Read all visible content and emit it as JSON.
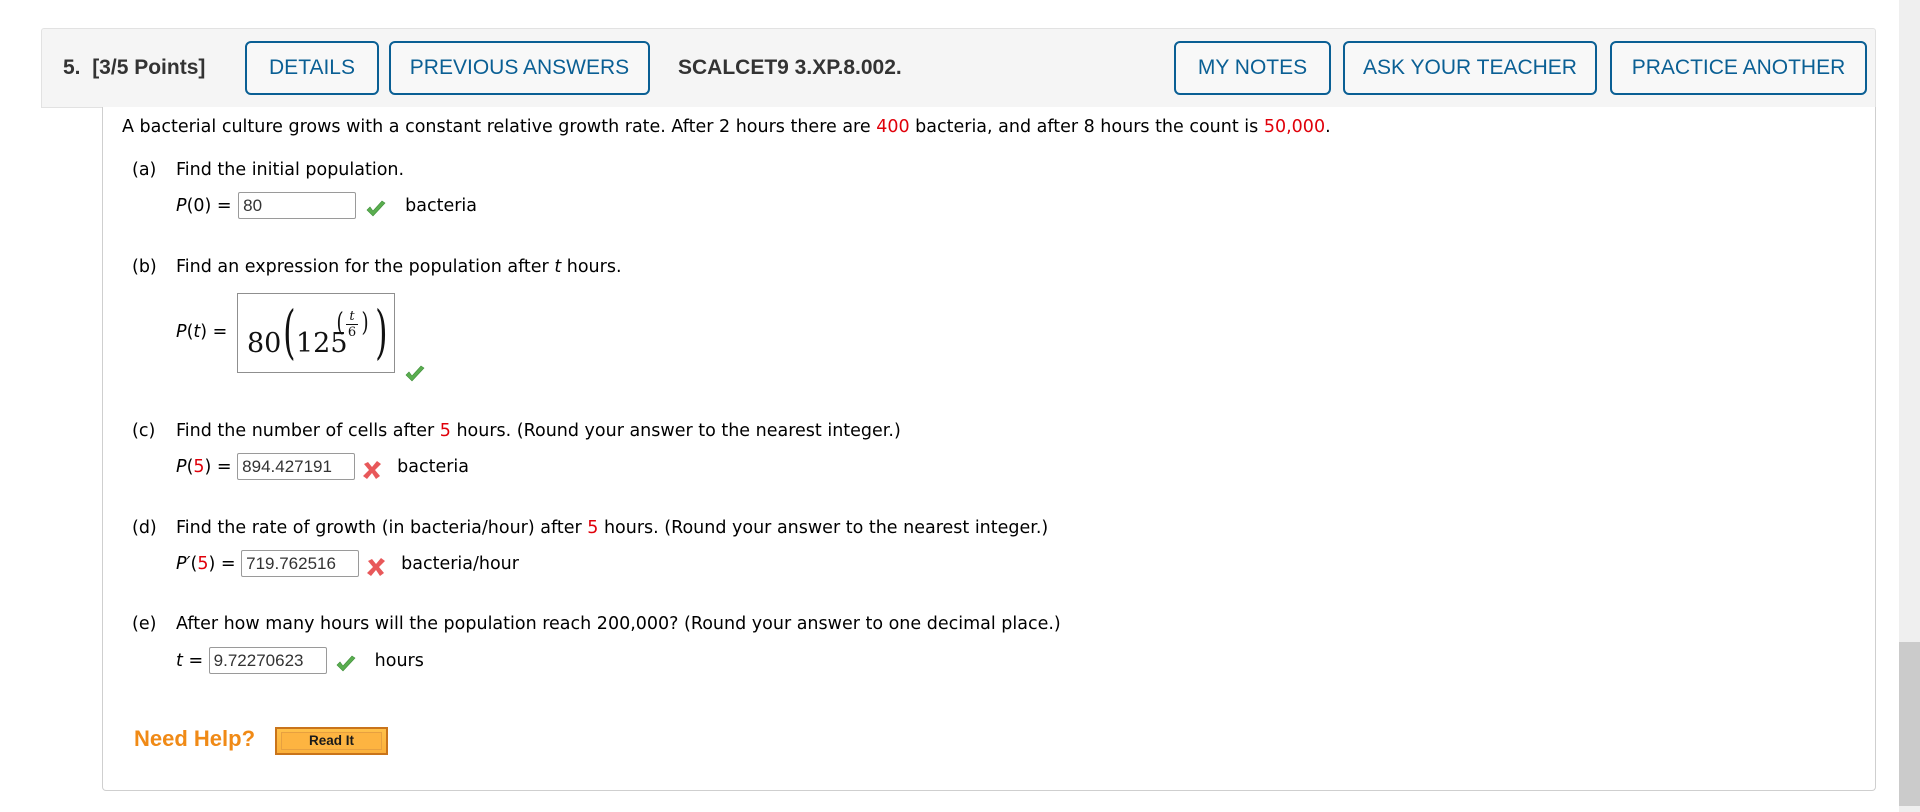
{
  "header": {
    "question_number": "5.",
    "points": "[3/5 Points]",
    "buttons": {
      "details": "DETAILS",
      "previous_answers": "PREVIOUS ANSWERS",
      "my_notes": "MY NOTES",
      "ask_teacher": "ASK YOUR TEACHER",
      "practice_another": "PRACTICE ANOTHER"
    },
    "question_id": "SCALCET9 3.XP.8.002."
  },
  "intro": {
    "part1": "A bacterial culture grows with a constant relative growth rate. After 2 hours there are ",
    "value1": "400",
    "part2": " bacteria, and after 8 hours the count is ",
    "value2": "50,000",
    "part3": "."
  },
  "parts": [
    {
      "label": "(a)",
      "question": "Find the initial population.",
      "lhs_fn": "P",
      "lhs_arg": "0",
      "answer": "80",
      "unit": "bacteria",
      "status": "correct"
    },
    {
      "label": "(b)",
      "question_pre": "Find an expression for the population after ",
      "question_var": "t",
      "question_post": " hours.",
      "lhs_fn": "P",
      "lhs_arg": "t",
      "answer_expr": {
        "coef": "80",
        "base": "125",
        "exp_num": "t",
        "exp_den": "6"
      },
      "status": "correct"
    },
    {
      "label": "(c)",
      "question_pre": "Find the number of cells after ",
      "question_value": "5",
      "question_post": " hours. (Round your answer to the nearest integer.)",
      "lhs_fn": "P",
      "lhs_arg": "5",
      "answer": "894.427191",
      "unit": "bacteria",
      "status": "incorrect"
    },
    {
      "label": "(d)",
      "question_pre": "Find the rate of growth (in bacteria/hour) after ",
      "question_value": "5",
      "question_post": " hours. (Round your answer to the nearest integer.)",
      "lhs_fn": "P′",
      "lhs_arg": "5",
      "answer": "719.762516",
      "unit": "bacteria/hour",
      "status": "incorrect"
    },
    {
      "label": "(e)",
      "question": "After how many hours will the population reach 200,000? (Round your answer to one decimal place.)",
      "lhs_var": "t",
      "answer": "9.72270623",
      "unit": "hours",
      "status": "correct"
    }
  ],
  "help": {
    "label": "Need Help?",
    "read_it": "Read It"
  },
  "icons": {
    "correct": "check-icon",
    "incorrect": "x-icon"
  },
  "colors": {
    "accent": "#0a5f94",
    "highlight_value": "#e0000a",
    "correct": "#5aae4f",
    "incorrect": "#e8585a",
    "help": "#f08a16"
  }
}
